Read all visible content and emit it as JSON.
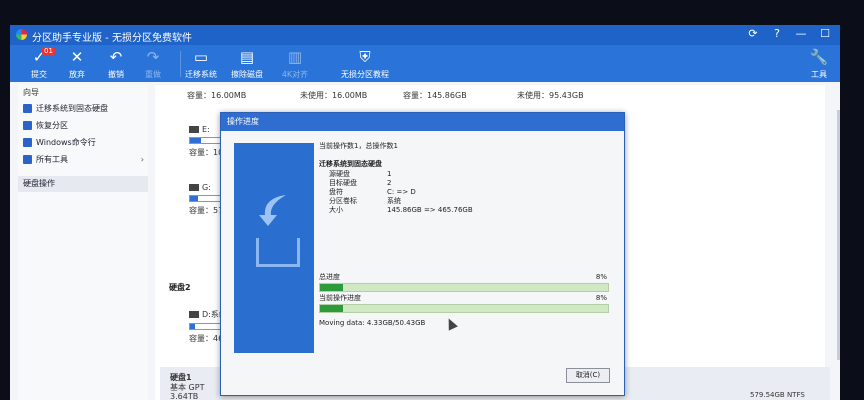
{
  "window": {
    "title": "分区助手专业版 - 无损分区免费软件",
    "controls": [
      "⟳",
      "?",
      "—",
      "☐"
    ]
  },
  "toolbar": {
    "badge": "01",
    "buttons": [
      {
        "label": "提交",
        "icon": "✓",
        "enabled": true
      },
      {
        "label": "放弃",
        "icon": "✕",
        "enabled": true
      },
      {
        "label": "撤销",
        "icon": "↶",
        "enabled": true
      },
      {
        "label": "重做",
        "icon": "↷",
        "enabled": false
      },
      {
        "label": "迁移系统",
        "icon": "▭",
        "enabled": true
      },
      {
        "label": "擦除磁盘",
        "icon": "▤",
        "enabled": true
      },
      {
        "label": "4K对齐",
        "icon": "▥",
        "enabled": false
      },
      {
        "label": "无损分区教程",
        "icon": "⛨",
        "enabled": true
      }
    ],
    "tools_label": "工具"
  },
  "sidebar": {
    "header": "向导",
    "items": [
      {
        "label": "迁移系统到固态硬盘"
      },
      {
        "label": "恢复分区"
      },
      {
        "label": "Windows命令行"
      },
      {
        "label": "所有工具",
        "arrow": "›"
      }
    ],
    "section": "硬盘操作"
  },
  "main": {
    "cap1": "容量：16.00MB",
    "free1": "未使用：16.00MB",
    "cap2": "容量：145.86GB",
    "free2": "未使用：95.43GB",
    "part_e": {
      "letter": "E:",
      "cap": "容量：1000."
    },
    "part_g": {
      "letter": "G:",
      "cap": "容量：579.5"
    },
    "disk2": "硬盘2",
    "part_d": {
      "letter": "D:系统",
      "cap": "容量：465.2"
    },
    "disk1": {
      "name": "硬盘1",
      "type": "基本 GPT",
      "size": "3.64TB",
      "part_size": "579.54GB NTFS"
    }
  },
  "dialog": {
    "title": "操作进度",
    "current_line": "当前操作数1，总操作数1",
    "operation": "迁移系统到固态硬盘",
    "details": [
      {
        "k": "源硬盘",
        "v": "1"
      },
      {
        "k": "目标硬盘",
        "v": "2"
      },
      {
        "k": "盘符",
        "v": "C: => D"
      },
      {
        "k": "分区卷标",
        "v": "系统"
      },
      {
        "k": "大小",
        "v": "145.86GB => 465.76GB"
      }
    ],
    "total_label": "总进度",
    "total_pct": "8%",
    "total_value": 0.08,
    "current_label": "当前操作进度",
    "current_pct": "8%",
    "current_value": 0.08,
    "moving": "Moving data: 4.33GB/50.43GB",
    "cancel": "取消(C)"
  }
}
